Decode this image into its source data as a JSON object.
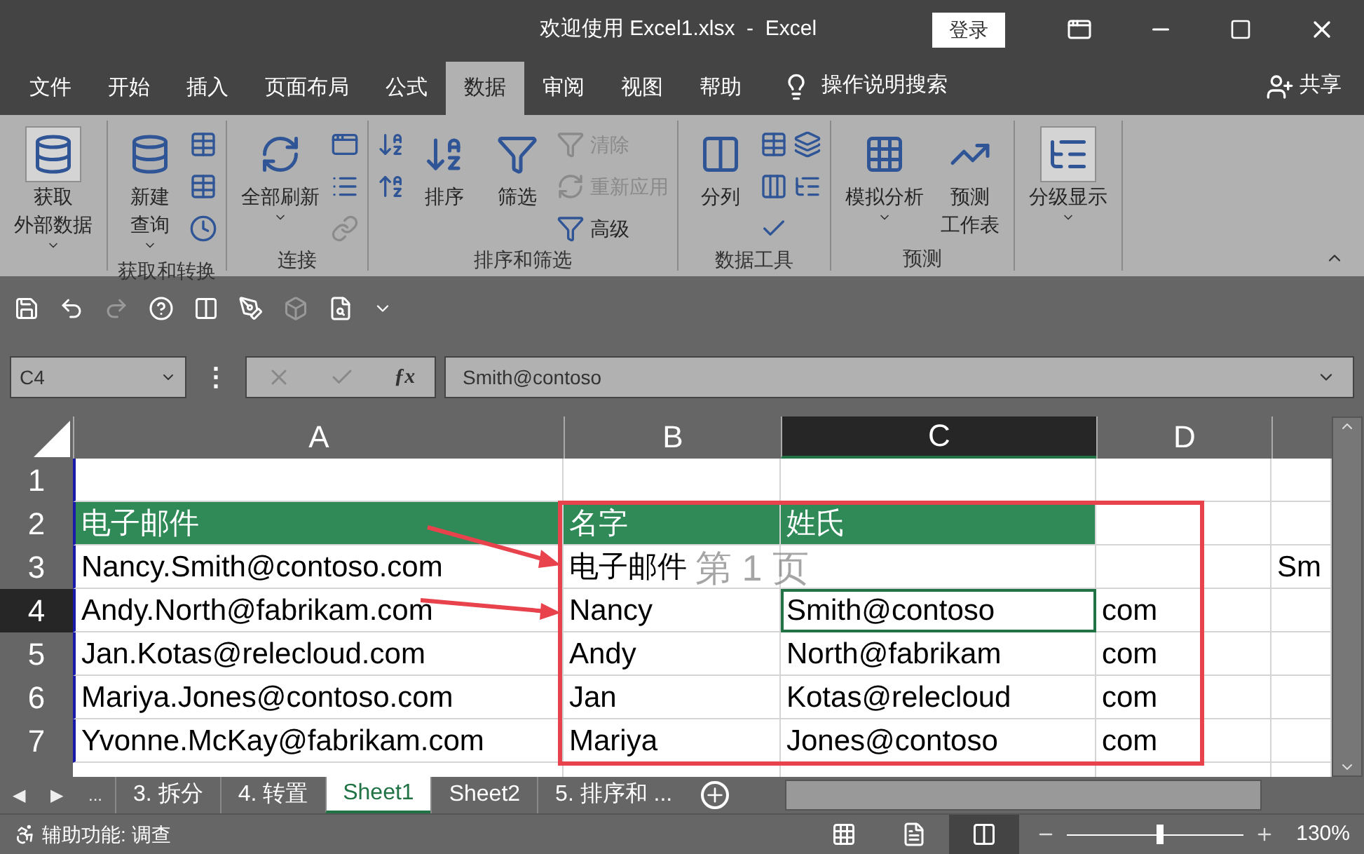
{
  "window": {
    "title": "欢迎使用 Excel1.xlsx  -  Excel",
    "signin": "登录"
  },
  "tabs": [
    {
      "label": "文件",
      "selected": false
    },
    {
      "label": "开始",
      "selected": false
    },
    {
      "label": "插入",
      "selected": false
    },
    {
      "label": "页面布局",
      "selected": false
    },
    {
      "label": "公式",
      "selected": false
    },
    {
      "label": "数据",
      "selected": true
    },
    {
      "label": "审阅",
      "selected": false
    },
    {
      "label": "视图",
      "selected": false
    },
    {
      "label": "帮助",
      "selected": false
    }
  ],
  "tell_me": "操作说明搜索",
  "share": "共享",
  "ribbon": [
    {
      "items": [
        {
          "kind": "large",
          "lines": [
            "获取",
            "外部数据"
          ],
          "dropdown": true,
          "pressed": true
        }
      ]
    },
    {
      "label": "获取和转换",
      "items": [
        {
          "kind": "large",
          "lines": [
            "新建",
            "查询"
          ],
          "dropdown": true,
          "pressed": false
        },
        {
          "kind": "column",
          "entries": [
            {
              "disabled": false
            },
            {
              "disabled": false
            },
            {
              "disabled": false
            }
          ]
        }
      ]
    },
    {
      "label": "连接",
      "items": [
        {
          "kind": "large",
          "lines": [
            "全部刷新"
          ],
          "dropdown": true,
          "pressed": false
        },
        {
          "kind": "column",
          "entries": [
            {
              "disabled": false
            },
            {
              "disabled": false
            },
            {
              "disabled": true
            }
          ]
        }
      ]
    },
    {
      "label": "排序和筛选",
      "items": [
        {
          "kind": "column",
          "entries": [
            {
              "disabled": false
            },
            {
              "disabled": false
            }
          ]
        },
        {
          "kind": "large",
          "lines": [
            "排序"
          ],
          "dropdown": false,
          "pressed": false
        },
        {
          "kind": "large",
          "lines": [
            "筛选"
          ],
          "dropdown": false,
          "pressed": false
        },
        {
          "kind": "column",
          "entries": [
            {
              "text": "清除",
              "disabled": true
            },
            {
              "text": "重新应用",
              "disabled": true
            },
            {
              "text": "高级",
              "disabled": false
            }
          ]
        }
      ]
    },
    {
      "label": "数据工具",
      "items": [
        {
          "kind": "large",
          "lines": [
            "分列"
          ],
          "dropdown": false,
          "pressed": false
        },
        {
          "kind": "column",
          "entries": [
            {
              "disabled": false
            },
            {
              "disabled": false
            },
            {
              "disabled": false
            }
          ]
        },
        {
          "kind": "column",
          "entries": [
            {
              "disabled": false
            },
            {
              "disabled": false
            }
          ]
        }
      ]
    },
    {
      "label": "预测",
      "items": [
        {
          "kind": "large",
          "lines": [
            "模拟分析"
          ],
          "dropdown": true,
          "pressed": false
        },
        {
          "kind": "large",
          "lines": [
            "预测",
            "工作表"
          ],
          "dropdown": false,
          "pressed": false
        }
      ]
    },
    {
      "items": [
        {
          "kind": "large",
          "lines": [
            "分级显示"
          ],
          "dropdown": true,
          "pressed": true
        }
      ]
    }
  ],
  "name_box": "C4",
  "formula_bar_grip": "⋮",
  "function_button": "ƒx",
  "formula": "Smith@contoso",
  "columns": [
    {
      "label": "A",
      "selected": false
    },
    {
      "label": "B",
      "selected": false
    },
    {
      "label": "C",
      "selected": true
    },
    {
      "label": "D",
      "selected": false
    },
    {
      "selected": false
    }
  ],
  "rows": [
    {
      "number": "1",
      "selected": false,
      "cells": [
        {
          "kind": "plain"
        },
        {
          "kind": "plain"
        },
        {
          "kind": "plain"
        },
        {
          "kind": "plain"
        },
        {
          "kind": "plain"
        }
      ]
    },
    {
      "number": "2",
      "selected": false,
      "cells": [
        {
          "text": "电子邮件",
          "kind": "header"
        },
        {
          "text": "名字",
          "kind": "header"
        },
        {
          "text": "姓氏",
          "kind": "header"
        },
        {
          "kind": "plain"
        },
        {
          "kind": "plain"
        }
      ]
    },
    {
      "number": "3",
      "selected": false,
      "cells": [
        {
          "text": "Nancy.Smith@contoso.com",
          "kind": "plain"
        },
        {
          "text": "电子邮件",
          "kind": "plain"
        },
        {
          "kind": "plain"
        },
        {
          "kind": "plain"
        },
        {
          "text": "Sm",
          "kind": "plain"
        }
      ]
    },
    {
      "number": "4",
      "selected": true,
      "cells": [
        {
          "text": "Andy.North@fabrikam.com",
          "kind": "plain"
        },
        {
          "text": "Nancy",
          "kind": "plain"
        },
        {
          "text": "Smith@contoso",
          "kind": "active"
        },
        {
          "text": "com",
          "kind": "plain"
        },
        {
          "kind": "plain"
        }
      ]
    },
    {
      "number": "5",
      "selected": false,
      "cells": [
        {
          "text": "Jan.Kotas@relecloud.com",
          "kind": "plain"
        },
        {
          "text": "Andy",
          "kind": "plain"
        },
        {
          "text": "North@fabrikam",
          "kind": "plain"
        },
        {
          "text": "com",
          "kind": "plain"
        },
        {
          "kind": "plain"
        }
      ]
    },
    {
      "number": "6",
      "selected": false,
      "cells": [
        {
          "text": "Mariya.Jones@contoso.com",
          "kind": "plain"
        },
        {
          "text": "Jan",
          "kind": "plain"
        },
        {
          "text": "Kotas@relecloud",
          "kind": "plain"
        },
        {
          "text": "com",
          "kind": "plain"
        },
        {
          "kind": "plain"
        }
      ]
    },
    {
      "number": "7",
      "selected": false,
      "cells": [
        {
          "text": "Yvonne.McKay@fabrikam.com",
          "kind": "plain"
        },
        {
          "text": "Mariya",
          "kind": "plain"
        },
        {
          "text": "Jones@contoso",
          "kind": "plain"
        },
        {
          "text": "com",
          "kind": "plain"
        },
        {
          "kind": "plain"
        }
      ]
    }
  ],
  "page_label": "第 1 页",
  "sheet_nav": [
    "◀",
    "▶",
    "..."
  ],
  "sheets": [
    {
      "label": "3. 拆分",
      "selected": false
    },
    {
      "label": "4. 转置",
      "selected": false
    },
    {
      "label": "Sheet1",
      "selected": true
    },
    {
      "label": "Sheet2",
      "selected": false
    },
    {
      "label": "5. 排序和 ...",
      "selected": false
    }
  ],
  "status": "辅助功能: 调查",
  "views": [
    {
      "selected": false
    },
    {
      "selected": false
    },
    {
      "selected": true
    }
  ],
  "zoom": {
    "level": 0.53,
    "reading": "130%"
  }
}
